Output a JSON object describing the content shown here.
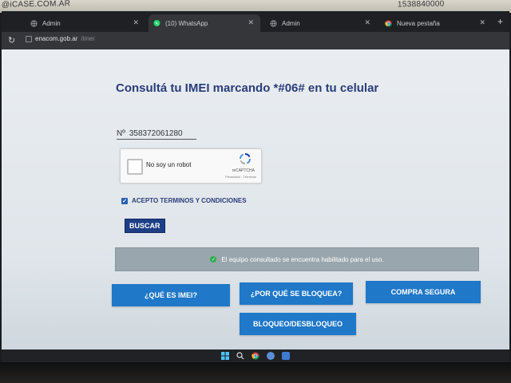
{
  "stickers": {
    "left": "@iCASE.COM.AR",
    "right": "1538840000"
  },
  "browser": {
    "tabs": [
      {
        "label": "Admin",
        "icon": "globe-icon"
      },
      {
        "label": "(10) WhatsApp",
        "icon": "whatsapp-icon"
      },
      {
        "label": "Admin",
        "icon": "globe-icon"
      },
      {
        "label": "Nueva pestaña",
        "icon": "chrome-icon"
      }
    ],
    "new_tab": "+",
    "url_domain": "enacom.gob.ar",
    "url_path": "/imei"
  },
  "page": {
    "title": "Consultá tu IMEI marcando *#06# en tu celular",
    "imei_prefix": "Nº",
    "imei_value": "358372061280",
    "captcha": {
      "label": "No soy un robot",
      "brand": "reCAPTCHA",
      "links": "Privacidad - Términos"
    },
    "terms_label": "ACEPTO TERMINOS Y CONDICIONES",
    "terms_checked": true,
    "search_button": "BUSCAR",
    "status_message": "El equipo consultado se encuentra habilitado para el uso.",
    "buttons": {
      "que_es": "¿QUÉ ES IMEI?",
      "por_que": "¿POR QUÉ SE BLOQUEA?",
      "compra": "COMPRA SEGURA",
      "bloqueo": "BLOQUEO/DESBLOQUEO"
    }
  },
  "colors": {
    "title": "#2a3d7a",
    "nav_button": "#1f78c8",
    "search_button": "#1d3f86",
    "status_bg": "#9aa6ad",
    "status_ok": "#2fae4e"
  },
  "taskbar": {
    "icons": [
      "windows-start-icon",
      "search-icon",
      "chrome-icon",
      "app-icon",
      "app-icon-2"
    ]
  }
}
